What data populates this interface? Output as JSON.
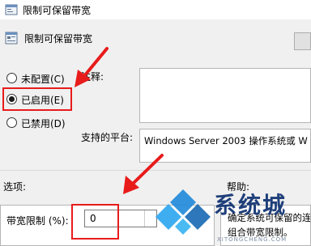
{
  "window": {
    "title": "限制可保留带宽"
  },
  "header": {
    "title": "限制可保留带宽"
  },
  "options": [
    {
      "label": "未配置(C)",
      "selected": false
    },
    {
      "label": "已启用(E)",
      "selected": true
    },
    {
      "label": "已禁用(D)",
      "selected": false
    }
  ],
  "comment": {
    "label": "注释:"
  },
  "platform": {
    "label": "支持的平台:",
    "value": "Windows Server 2003 操作系统或 W"
  },
  "sections": {
    "options": "选项:",
    "help": "帮助:"
  },
  "setting": {
    "label": "带宽限制 (%):",
    "value": "0"
  },
  "help_text": {
    "line1": "确定系统可保留的连",
    "line2": "组合带宽限制。"
  },
  "watermark": {
    "text": "系统城",
    "url": "XITONGCHENG.COM"
  }
}
